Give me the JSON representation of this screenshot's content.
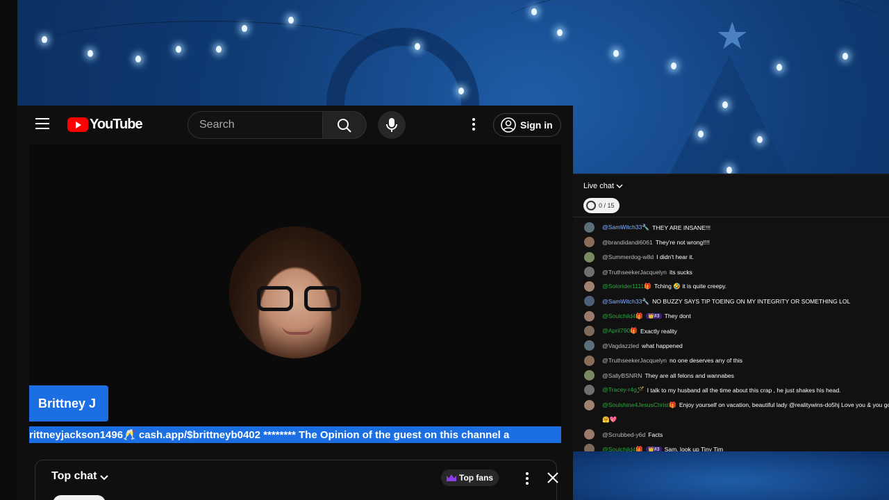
{
  "header": {
    "logo_text": "YouTube",
    "search_placeholder": "Search",
    "signin_label": "Sign in"
  },
  "video": {
    "name_tag": "Brittney J",
    "ticker_text": "rittneyjackson1496🥂 cash.app/$brittneyb0402 ******** The Opinion of the guest on this channel a"
  },
  "top_chat": {
    "title": "Top chat",
    "top_fans_label": "Top fans"
  },
  "live_chat": {
    "title": "Live chat",
    "goal_text": "0 / 15",
    "messages": [
      {
        "user": "@SamWitch33🔧",
        "text": "THEY ARE INSANE!!!",
        "style": "mod",
        "badge": ""
      },
      {
        "user": "@brandidandi6061",
        "text": "They're not wrong!!!!",
        "style": "",
        "badge": ""
      },
      {
        "user": "@Summerdog-w8d",
        "text": "I didn't hear it.",
        "style": "",
        "badge": ""
      },
      {
        "user": "@TruthseekerJacquelyn",
        "text": "its sucks",
        "style": "",
        "badge": ""
      },
      {
        "user": "@Solorider1111🎁",
        "text": "Tching 🤣 it is quite creepy.",
        "style": "green",
        "badge": ""
      },
      {
        "user": "@SamWitch33🔧",
        "text": "NO BUZZY SAYS TIP TOEING ON MY INTEGRITY OR SOMETHING LOL",
        "style": "mod",
        "badge": ""
      },
      {
        "user": "@Soulchild4🎁",
        "text": "They dont",
        "style": "green",
        "badge": "👑#3"
      },
      {
        "user": "@April790🎁",
        "text": "Exactly reality",
        "style": "green",
        "badge": ""
      },
      {
        "user": "@Vagdazzled",
        "text": "what happened",
        "style": "",
        "badge": ""
      },
      {
        "user": "@TruthseekerJacquelyn",
        "text": "no one deserves any of this",
        "style": "",
        "badge": ""
      },
      {
        "user": "@SallyBSNRN",
        "text": "They are all felons and wannabes",
        "style": "",
        "badge": ""
      },
      {
        "user": "@Tracey-r4g🪄",
        "text": "I talk to my husband all the time about this crap , he just shakes his head.",
        "style": "green",
        "badge": ""
      },
      {
        "user": "@Soulshine4JesusChrist🎁",
        "text": "Enjoy yourself on vacation, beautiful lady @realitywins-do5hj Love you & you go g",
        "style": "green",
        "badge": ""
      },
      {
        "user": "",
        "text": "🤗💖",
        "style": "",
        "badge": ""
      },
      {
        "user": "@Scrubbed-y6d",
        "text": "Facts",
        "style": "",
        "badge": ""
      },
      {
        "user": "@Soulchild4🎁",
        "text": "Sam, look up Tiny Tim",
        "style": "green",
        "badge": "👑#3"
      }
    ]
  },
  "colors": {
    "brand_red": "#ff0000",
    "accent_blue": "#1b6fe3",
    "background_blue": "#0f3a73"
  }
}
